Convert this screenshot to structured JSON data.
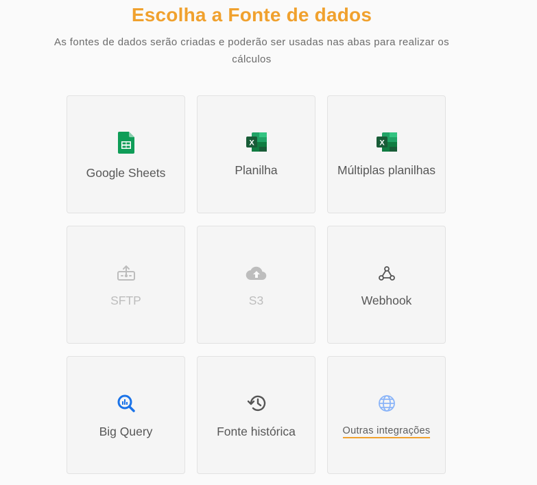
{
  "header": {
    "title": "Escolha a Fonte de dados",
    "subtitle": "As fontes de dados serão criadas e poderão ser usadas nas abas para realizar os cálculos"
  },
  "colors": {
    "accent": "#f0a12e",
    "sheets_green": "#0f9d58",
    "excel_green": "#1d6f42",
    "bigquery_blue": "#1a73e8",
    "globe_blue": "#8ab4f8"
  },
  "sources": [
    {
      "label": "Google Sheets",
      "icon": "google-sheets-icon",
      "enabled": true
    },
    {
      "label": "Planilha",
      "icon": "excel-icon",
      "enabled": true
    },
    {
      "label": "Múltiplas planilhas",
      "icon": "excel-icon",
      "enabled": true
    },
    {
      "label": "SFTP",
      "icon": "sftp-upload-icon",
      "enabled": false
    },
    {
      "label": "S3",
      "icon": "cloud-upload-icon",
      "enabled": false
    },
    {
      "label": "Webhook",
      "icon": "webhook-icon",
      "enabled": true
    },
    {
      "label": "Big Query",
      "icon": "bigquery-icon",
      "enabled": true
    },
    {
      "label": "Fonte histórica",
      "icon": "history-icon",
      "enabled": true
    },
    {
      "label": "Outras integrações",
      "icon": "globe-icon",
      "enabled": true
    }
  ]
}
